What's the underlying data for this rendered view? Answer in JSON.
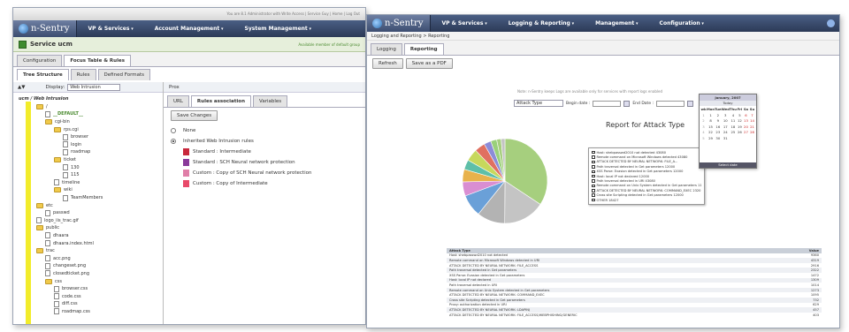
{
  "w1": {
    "topbar_text": "You are 8.1 Administrator with Write Access | Service Guy | Home | Log Out",
    "logo": "n-Sentry",
    "menus": [
      "VP & Services",
      "Account Management",
      "System Management"
    ],
    "service_title": "Service ucm",
    "service_right": "Available  member of default group",
    "tabs": [
      "Configuration",
      "Focus Table & Rules"
    ],
    "subtabs": [
      "Tree Structure",
      "Rules",
      "Defined Formats"
    ],
    "display_label": "Display:",
    "display_value": "Web Intrusion",
    "tree": [
      {
        "label": "ucm / Web Intrusion",
        "indent": 0,
        "type": "root"
      },
      {
        "label": "/",
        "indent": 1,
        "type": "folder"
      },
      {
        "label": "__DEFAULT__",
        "indent": 2,
        "type": "file"
      },
      {
        "label": "cgi-bin",
        "indent": 2,
        "type": "folder"
      },
      {
        "label": "rps.cgi",
        "indent": 3,
        "type": "folder"
      },
      {
        "label": "browser",
        "indent": 4,
        "type": "file"
      },
      {
        "label": "login",
        "indent": 4,
        "type": "file"
      },
      {
        "label": "roadmap",
        "indent": 4,
        "type": "file"
      },
      {
        "label": "ticket",
        "indent": 3,
        "type": "folder"
      },
      {
        "label": "130",
        "indent": 4,
        "type": "file"
      },
      {
        "label": "115",
        "indent": 4,
        "type": "file"
      },
      {
        "label": "timeline",
        "indent": 3,
        "type": "file"
      },
      {
        "label": "wiki",
        "indent": 3,
        "type": "folder"
      },
      {
        "label": "TeamMembers",
        "indent": 4,
        "type": "file"
      },
      {
        "label": "etc",
        "indent": 1,
        "type": "folder"
      },
      {
        "label": "passwd",
        "indent": 2,
        "type": "file"
      },
      {
        "label": "logo_iis_trac.gif",
        "indent": 1,
        "type": "file"
      },
      {
        "label": "public",
        "indent": 1,
        "type": "folder"
      },
      {
        "label": "dhaara",
        "indent": 2,
        "type": "file"
      },
      {
        "label": "dhaara.index.html",
        "indent": 2,
        "type": "file"
      },
      {
        "label": "trac",
        "indent": 1,
        "type": "folder"
      },
      {
        "label": "acc.png",
        "indent": 2,
        "type": "file"
      },
      {
        "label": "changeset.png",
        "indent": 2,
        "type": "file"
      },
      {
        "label": "closedticket.png",
        "indent": 2,
        "type": "file"
      },
      {
        "label": "css",
        "indent": 2,
        "type": "folder"
      },
      {
        "label": "browser.css",
        "indent": 3,
        "type": "file"
      },
      {
        "label": "code.css",
        "indent": 3,
        "type": "file"
      },
      {
        "label": "diff.css",
        "indent": 3,
        "type": "file"
      },
      {
        "label": "roadmap.css",
        "indent": 3,
        "type": "file"
      }
    ],
    "right_header": "Prox",
    "right_tabs": [
      "URL",
      "Rules association",
      "Variables"
    ],
    "save_label": "Save Changes",
    "rules": [
      {
        "label": "None",
        "color": "",
        "selected": false
      },
      {
        "label": "Inherited Web Intrusion rules",
        "color": "",
        "selected": true
      },
      {
        "label": "Standard : Intermediate",
        "color": "#c8283c",
        "selected": false
      },
      {
        "label": "Standard : SCH Neural network protection",
        "color": "#8a3a9a",
        "selected": false
      },
      {
        "label": "Custom : Copy of SCH Neural network protection",
        "color": "#e07fa8",
        "selected": false
      },
      {
        "label": "Custom : Copy of Intermediate",
        "color": "#e84a6a",
        "selected": false
      }
    ]
  },
  "w2": {
    "logo": "n-Sentry",
    "menus": [
      "VP & Services",
      "Logging & Reporting",
      "Management",
      "Configuration"
    ],
    "breadcrumb": "Logging and Reporting > Reporting",
    "tabs": [
      "Logging",
      "Reporting"
    ],
    "buttons": [
      "Refresh",
      "Save as a PDF"
    ],
    "desc": "Note: n-Sentry keeps Logs are available only for services with report logs enabled",
    "attack_select": "Attack Type",
    "begin_label": "Begin date :",
    "end_label": "End Date :",
    "report_title": "Report for Attack Type",
    "pie_colors": [
      "#a6cf7e",
      "#c4c4c4",
      "#b3b3b3",
      "#6aa0d8",
      "#d98ed2",
      "#e8b24c",
      "#5ebfa8",
      "#c7d85c",
      "#e07060",
      "#8c8cd8",
      "#9ad07a"
    ],
    "legend": [
      "Host: shebpasswd2010 not detected 43080",
      "Remote command on Microsoft Windows detected 43080",
      "ATTACK DETECTED BY NEURAL NETWORK: FILE_A...",
      "Path traversal detected in Get parameters 12000",
      "XSS Parse: Evasion detected in Get parameters 12000",
      "Host: local IP not declared 12000",
      "Path traversal detected in URI 43080",
      "Remote command on Unix System detected in Get parameters 11700",
      "ATTACK DETECTED BY NEURAL NETWORK: COMMAND_EXEC 2320",
      "Cross site Scripting detected in Get parameters 12000",
      "OTHER 18427"
    ],
    "calendar": {
      "title": "January, 2007",
      "today": "Today",
      "days": [
        "wk",
        "Mon",
        "Tue",
        "Wed",
        "Thu",
        "Fri",
        "Sa",
        "Su"
      ],
      "rows": [
        [
          "1",
          "1",
          "2",
          "3",
          "4",
          "5",
          "6",
          "7"
        ],
        [
          "2",
          "8",
          "9",
          "10",
          "11",
          "12",
          "13",
          "14"
        ],
        [
          "3",
          "15",
          "16",
          "17",
          "18",
          "19",
          "20",
          "21"
        ],
        [
          "4",
          "22",
          "23",
          "24",
          "25",
          "26",
          "27",
          "28"
        ],
        [
          "5",
          "29",
          "30",
          "31",
          "",
          "",
          "",
          ""
        ]
      ],
      "footer": "Select date"
    },
    "table": {
      "headers": [
        "Attack Type",
        "Value"
      ],
      "rows": [
        [
          "Host: shebpasswd2010 not detected",
          "9360"
        ],
        [
          "Remote command on Microsoft Windows detected in URI",
          "4319"
        ],
        [
          "ATTACK DETECTED BY NEURAL NETWORK: FILE_ACCESS",
          "2916"
        ],
        [
          "Path traversal detected in Get parameters",
          "2322"
        ],
        [
          "XSS Parse: Evasion detected in Get parameters",
          "1472"
        ],
        [
          "Host: local IP not declared",
          "1309"
        ],
        [
          "Path traversal detected in URI",
          "1014"
        ],
        [
          "Remote command on Unix System detected in Get parameters",
          "1273"
        ],
        [
          "ATTACK DETECTED BY NEURAL NETWORK: COMMAND_EXEC",
          "1095"
        ],
        [
          "Cross site Scripting detected in Get parameters",
          "732"
        ],
        [
          "Proxy: authorization detected in URI",
          "629"
        ],
        [
          "ATTACK DETECTED BY NEURAL NETWORK: LDAPINJ",
          "457"
        ],
        [
          "ATTACK DETECTED BY NEURAL NETWORK: FILE_ACCESS/WEBPHISHING/GENERIC",
          "403"
        ]
      ]
    }
  }
}
